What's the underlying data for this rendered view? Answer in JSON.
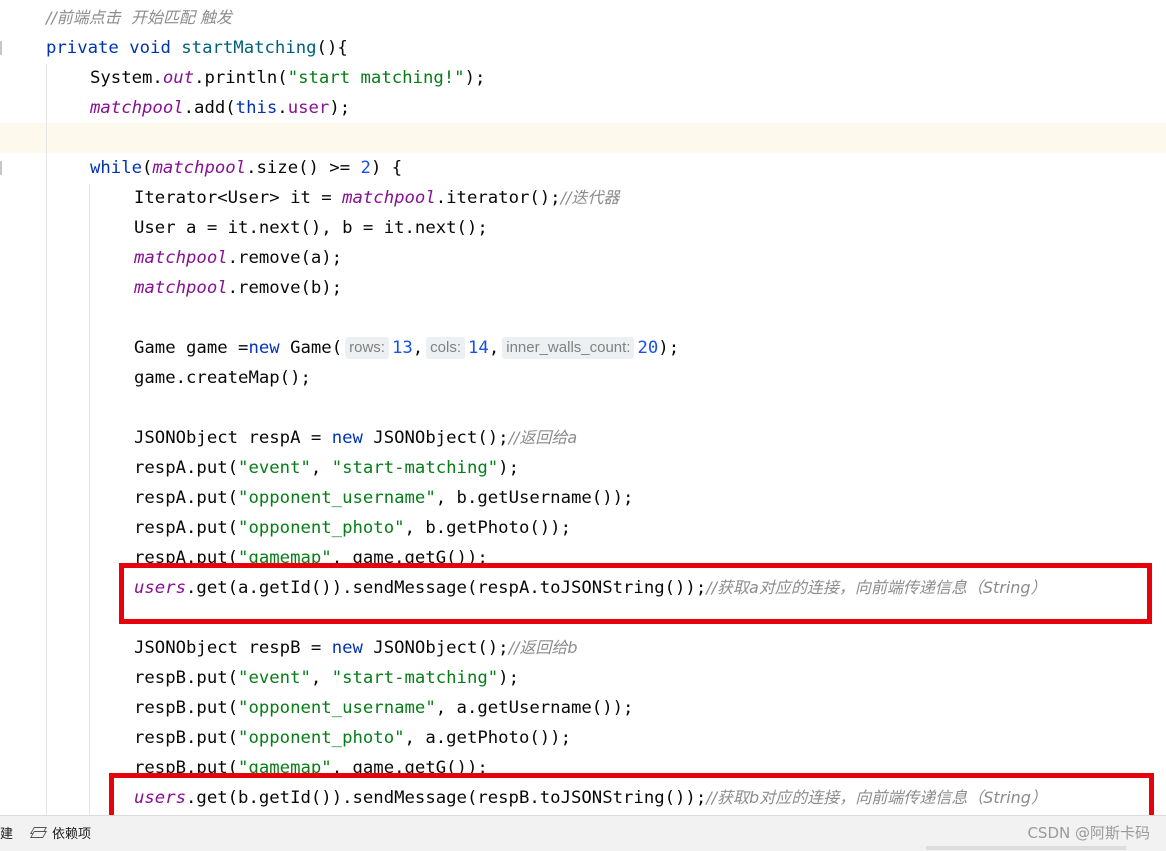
{
  "code": {
    "comment_header": "//前端点击  开始匹配 触发",
    "method_kw_private": "private",
    "method_kw_void": "void",
    "method_name": "startMatching",
    "method_open": "(){",
    "sys_prefix": "System.",
    "sys_out": "out",
    "sys_println": ".println(",
    "sys_str": "\"start matching!\"",
    "close_semicolon": ");",
    "matchpool": "matchpool",
    "add_call": ".add(",
    "this_kw": "this",
    "dot": ".",
    "user_field": "user",
    "while_kw": "while",
    "paren_open": "(",
    "size_cond": ".size() >= ",
    "size_num": "2",
    "while_close": ") {",
    "iter_decl": "Iterator<User> it = ",
    "iter_call": ".iterator();",
    "iter_comment": "//迭代器",
    "user_ab": "User a = it.next(), b = it.next();",
    "remove_a": ".remove(a);",
    "remove_b": ".remove(b);",
    "game_decl": "Game game =",
    "new_kw": "new",
    "game_ctor": " Game(",
    "hint_rows": "rows:",
    "rows_val": "13",
    "hint_cols": "cols:",
    "cols_val": "14",
    "hint_walls": "inner_walls_count:",
    "walls_val": "20",
    "comma": ",",
    "create_map": "game.createMap();",
    "respA_decl": "JSONObject respA = ",
    "json_ctor": " JSONObject();",
    "respA_comment": "//返回给a",
    "respA_put": "respA.put(",
    "respB_decl": "JSONObject respB = ",
    "respB_comment": "//返回给b",
    "respB_put": "respB.put(",
    "key_event": "\"event\"",
    "val_start_matching": "\"start-matching\"",
    "key_opp_username": "\"opponent_username\"",
    "a_username": "a.getUsername());",
    "b_username": "b.getUsername());",
    "key_opp_photo": "\"opponent_photo\"",
    "a_photo": "a.getPhoto());",
    "b_photo": "b.getPhoto());",
    "key_gamemap": "\"gamemap\"",
    "gamemap_val": ", game.getG());",
    "comma_space": ", ",
    "users_field": "users",
    "send_a": ".get(a.getId()).sendMessage(respA.toJSONString());",
    "send_b": ".get(b.getId()).sendMessage(respB.toJSONString());",
    "send_a_comment": "//获取a对应的连接，向前端传递信息（String）",
    "send_b_comment": "//获取b对应的连接，向前端传递信息（String）"
  },
  "statusbar": {
    "left_fragment": "建",
    "dependencies_label": "依赖项"
  },
  "watermark": "CSDN @阿斯卡码",
  "colors": {
    "highlight_border": "#e8000b",
    "keyword": "#0033b3",
    "field": "#871094",
    "string": "#067d17",
    "number": "#1750eb",
    "comment": "#8c8c8c"
  }
}
